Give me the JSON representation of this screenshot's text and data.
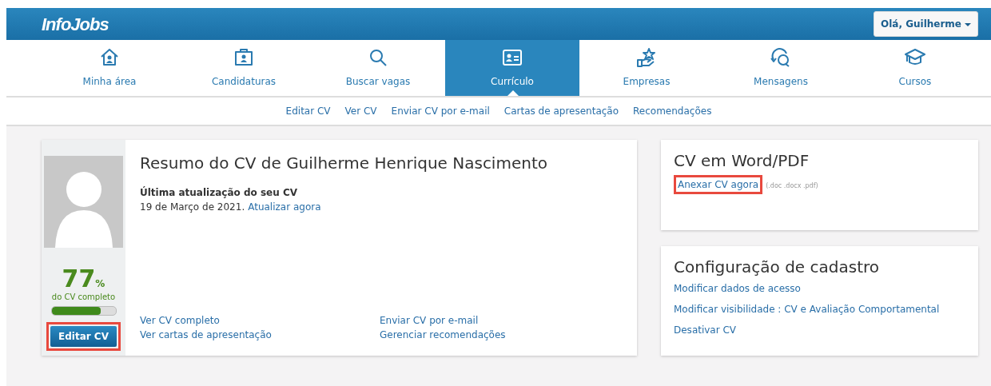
{
  "header": {
    "logo": "InfoJobs",
    "user_menu": "Olá, Guilherme"
  },
  "nav": [
    {
      "label": "Minha área",
      "selected": false
    },
    {
      "label": "Candidaturas",
      "selected": false
    },
    {
      "label": "Buscar vagas",
      "selected": false
    },
    {
      "label": "Currículo",
      "selected": true
    },
    {
      "label": "Empresas",
      "selected": false
    },
    {
      "label": "Mensagens",
      "selected": false
    },
    {
      "label": "Cursos",
      "selected": false
    }
  ],
  "subnav": [
    "Editar CV",
    "Ver CV",
    "Enviar CV por e-mail",
    "Cartas de apresentação",
    "Recomendações"
  ],
  "profile": {
    "completion": "77",
    "percent_sign": "%",
    "completion_label": "do CV completo",
    "level": 0.77,
    "edit_button": {
      "label": "Editar CV",
      "highlighted": true
    }
  },
  "summary": {
    "title": "Resumo do CV de",
    "name": "Guilherme Henrique Nascimento",
    "last_update_label": "Última atualização do seu CV",
    "date": "19 de Março de 2021.",
    "update_link": "Atualizar agora",
    "links": [
      "Ver CV completo",
      "Ver cartas de apresentação",
      "Enviar CV por e-mail",
      "Gerenciar recomendações"
    ]
  },
  "attach_card": {
    "title": "CV em Word/PDF",
    "link": {
      "label": "Anexar CV agora",
      "highlighted": true
    },
    "formats": "(.doc .docx .pdf)"
  },
  "settings_card": {
    "title": "Configuração de cadastro",
    "links": [
      "Modificar dados de acesso",
      "Modificar visibilidade : CV e Avaliação Comportamental",
      "Desativar CV"
    ]
  }
}
